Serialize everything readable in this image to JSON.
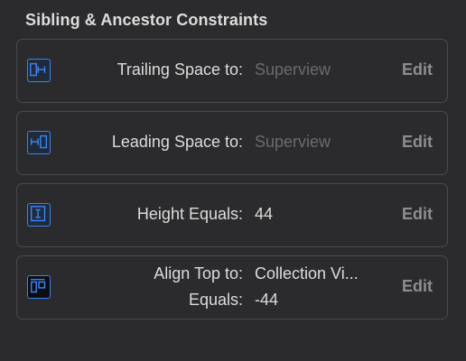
{
  "section": {
    "title": "Sibling & Ancestor Constraints"
  },
  "constraints": [
    {
      "label": "Trailing Space to:",
      "value": "Superview",
      "value_is_placeholder": true,
      "edit": "Edit",
      "icon": "trailing-space-icon"
    },
    {
      "label": "Leading Space to:",
      "value": "Superview",
      "value_is_placeholder": true,
      "edit": "Edit",
      "icon": "leading-space-icon"
    },
    {
      "label": "Height Equals:",
      "value": "44",
      "value_is_placeholder": false,
      "edit": "Edit",
      "icon": "height-icon"
    },
    {
      "label": "Align Top to:",
      "value": "Collection Vi...",
      "label2": "Equals:",
      "value2": "-44",
      "edit": "Edit",
      "icon": "align-top-icon"
    }
  ],
  "colors": {
    "accent": "#3a83f2",
    "background": "#2b2b2d",
    "border": "#4a4a4c"
  }
}
